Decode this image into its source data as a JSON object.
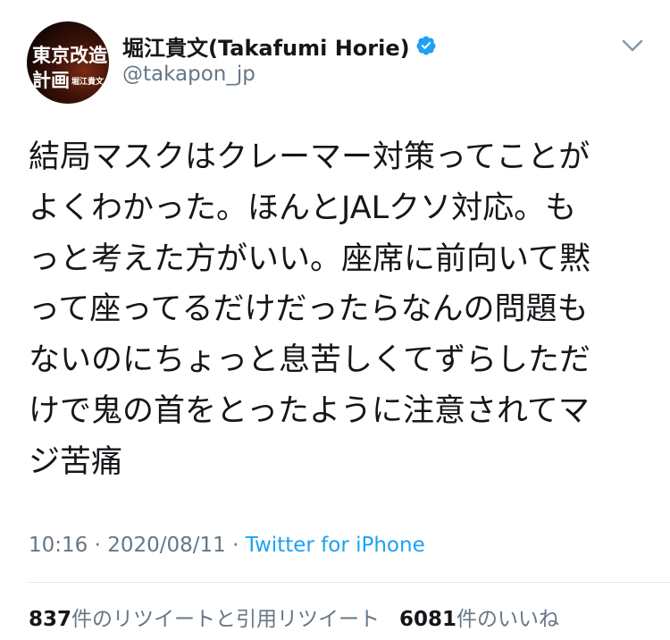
{
  "author": {
    "avatar_text": [
      "東京改造",
      "計画",
      "堀江貴文"
    ],
    "display_name": "堀江貴文(Takafumi Horie)",
    "handle": "@takapon_jp",
    "verified": true,
    "verified_icon": "verified-badge-icon"
  },
  "menu": {
    "icon": "chevron-down-icon"
  },
  "tweet": {
    "text": "結局マスクはクレーマー対策ってことが\nよくわかった。ほんとJALクソ対応。も\nっと考えた方がいい。座席に前向いて黙\nって座ってるだけだったらなんの問題も\nないのにちょっと息苦しくてずらしただ\nけで鬼の首をとったように注意されてマ\nジ苦痛"
  },
  "meta": {
    "time": "10:16",
    "separator": "·",
    "date": "2020/08/11",
    "source": "Twitter for iPhone"
  },
  "stats": {
    "retweets_count": "837",
    "retweets_label": "件のリツイートと引用リツイート",
    "likes_count": "6081",
    "likes_label": "件のいいね"
  },
  "colors": {
    "text": "#14171a",
    "secondary": "#657786",
    "accent": "#1da1f2",
    "divider": "#e1e8ed"
  }
}
